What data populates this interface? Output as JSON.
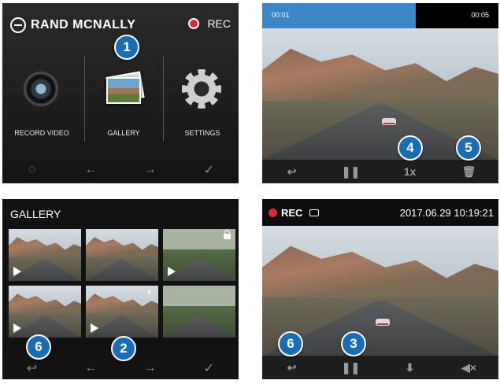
{
  "panel1": {
    "brand": "RAND MCNALLY",
    "rec_label": "REC",
    "items": [
      {
        "label": "RECORD VIDEO",
        "icon": "camera-lens-icon"
      },
      {
        "label": "GALLERY",
        "icon": "photos-icon"
      },
      {
        "label": "SETTINGS",
        "icon": "gear-icon"
      }
    ],
    "nav": [
      "wifi-icon",
      "arrow-left-icon",
      "arrow-right-icon",
      "check-icon"
    ],
    "nav_glyphs": [
      "◌",
      "←",
      "→",
      "✓"
    ],
    "badge": "1"
  },
  "panel2": {
    "time_current": "00:01",
    "time_total": "00:05",
    "progress_fraction": 0.65,
    "controls": [
      "↩",
      "❚❚",
      "1x",
      "🗑"
    ],
    "badges": [
      "4",
      "5"
    ]
  },
  "panel3": {
    "title": "GALLERY",
    "nav_glyphs": [
      "↩",
      "←",
      "→",
      "✓"
    ],
    "badges": [
      "6",
      "2"
    ]
  },
  "panel4": {
    "rec_label": "REC",
    "datetime": "2017.06.29  10:19:21",
    "controls": [
      "↩",
      "❚❚",
      "⬇",
      "◀×"
    ],
    "badges": [
      "6",
      "3"
    ]
  },
  "colors": {
    "accent_blue": "#1a6cb3",
    "rec_red": "#d8283a",
    "progress_blue": "#3a86c6"
  }
}
